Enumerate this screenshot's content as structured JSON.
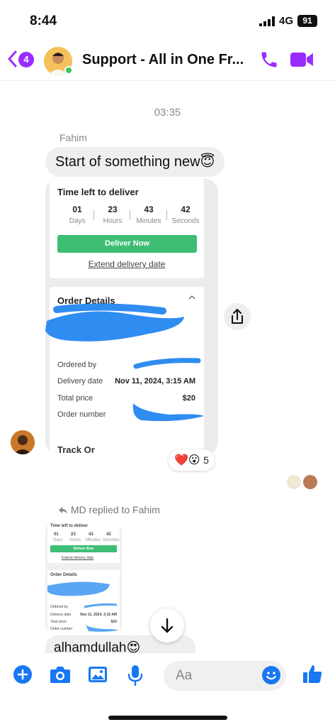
{
  "status_bar": {
    "time": "8:44",
    "network": "4G",
    "battery": "91"
  },
  "header": {
    "back_count": "4",
    "title": "Support - All in One Fr..."
  },
  "conversation": {
    "timestamp": "03:35",
    "sender_name": "Fahim",
    "first_message": "Start of something new😇",
    "order_card": {
      "time_left_title": "Time left to deliver",
      "timer": [
        {
          "value": "01",
          "unit": "Days"
        },
        {
          "value": "23",
          "unit": "Hours"
        },
        {
          "value": "43",
          "unit": "Minutes"
        },
        {
          "value": "42",
          "unit": "Seconds"
        }
      ],
      "deliver_button": "Deliver Now",
      "extend_link": "Extend delivery date",
      "details_title": "Order Details",
      "rows": [
        {
          "label": "Ordered by",
          "value": ""
        },
        {
          "label": "Delivery date",
          "value": "Nov 11, 2024, 3:15 AM"
        },
        {
          "label": "Total price",
          "value": "$20"
        },
        {
          "label": "Order number",
          "value": ""
        }
      ],
      "track_label": "Track Or"
    },
    "reactions": {
      "emojis": "❤️😮",
      "count": "5"
    },
    "reply_label": "MD replied to Fahim",
    "reply_thumbnail": {
      "time_left_title": "Time left to deliver",
      "timer": [
        {
          "value": "01",
          "unit": "Days"
        },
        {
          "value": "23",
          "unit": "Hours"
        },
        {
          "value": "43",
          "unit": "Minutes"
        },
        {
          "value": "42",
          "unit": "Seconds"
        }
      ],
      "deliver_button": "Deliver Now",
      "extend_link": "Extend delivery date",
      "details_title": "Order Details",
      "rows": [
        {
          "label": "Ordered by",
          "value": ""
        },
        {
          "label": "Delivery date",
          "value": "Nov 11, 2024, 3:15 AM"
        },
        {
          "label": "Total price",
          "value": "$20"
        },
        {
          "label": "Order number",
          "value": ""
        }
      ]
    },
    "partial_message": "alhamdullah😍"
  },
  "composer": {
    "placeholder": "Aa"
  },
  "colors": {
    "accent": "#9b2cff",
    "messenger_blue": "#1877f2",
    "deliver_green": "#3dbe74",
    "redaction_blue": "#2f8cf0"
  }
}
